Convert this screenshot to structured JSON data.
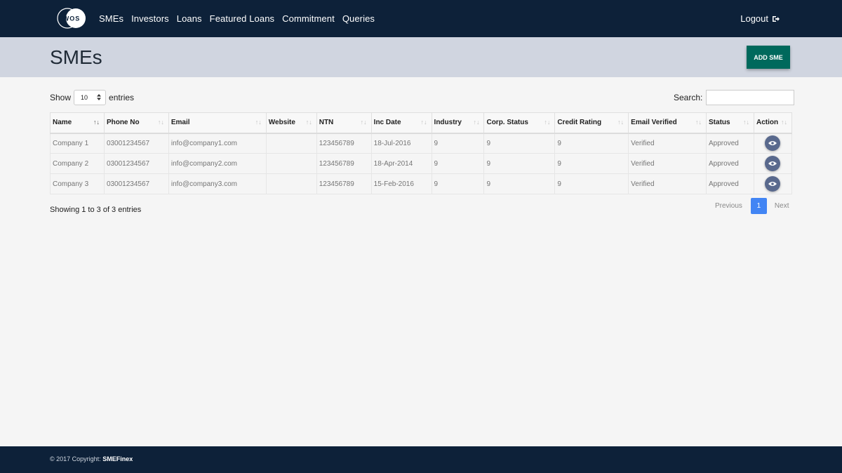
{
  "nav": {
    "logo_text": "WOS",
    "links": [
      "SMEs",
      "Investors",
      "Loans",
      "Featured Loans",
      "Commitment",
      "Queries"
    ],
    "logout": "Logout"
  },
  "header": {
    "title": "SMEs",
    "add_button": "ADD SME"
  },
  "controls": {
    "show_label": "Show",
    "entries_value": "10",
    "entries_label": "entries",
    "search_label": "Search:",
    "search_value": ""
  },
  "table": {
    "columns": [
      "Name",
      "Phone No",
      "Email",
      "Website",
      "NTN",
      "Inc Date",
      "Industry",
      "Corp. Status",
      "Credit Rating",
      "Email Verified",
      "Status",
      "Action"
    ],
    "rows": [
      [
        "Company 1",
        "03001234567",
        "info@company1.com",
        "",
        "123456789",
        "18-Jul-2016",
        "9",
        "9",
        "9",
        "Verified",
        "Approved"
      ],
      [
        "Company 2",
        "03001234567",
        "info@company2.com",
        "",
        "123456789",
        "18-Apr-2014",
        "9",
        "9",
        "9",
        "Verified",
        "Approved"
      ],
      [
        "Company 3",
        "03001234567",
        "info@company3.com",
        "",
        "123456789",
        "15-Feb-2016",
        "9",
        "9",
        "9",
        "Verified",
        "Approved"
      ]
    ]
  },
  "info": "Showing 1 to 3 of 3 entries",
  "pagination": {
    "prev": "Previous",
    "current": "1",
    "next": "Next"
  },
  "footer": {
    "prefix": "© 2017 Copyright:",
    "brand": "SMEFinex"
  },
  "colors": {
    "navbar": "#0d2139",
    "header_band": "#d0d5e0",
    "add_button": "#00695c",
    "page_active": "#4285f4",
    "view_button": "#59698d"
  },
  "icons": {
    "logout": "sign-out-icon",
    "view": "eye-icon",
    "sort": "sort-icon"
  }
}
